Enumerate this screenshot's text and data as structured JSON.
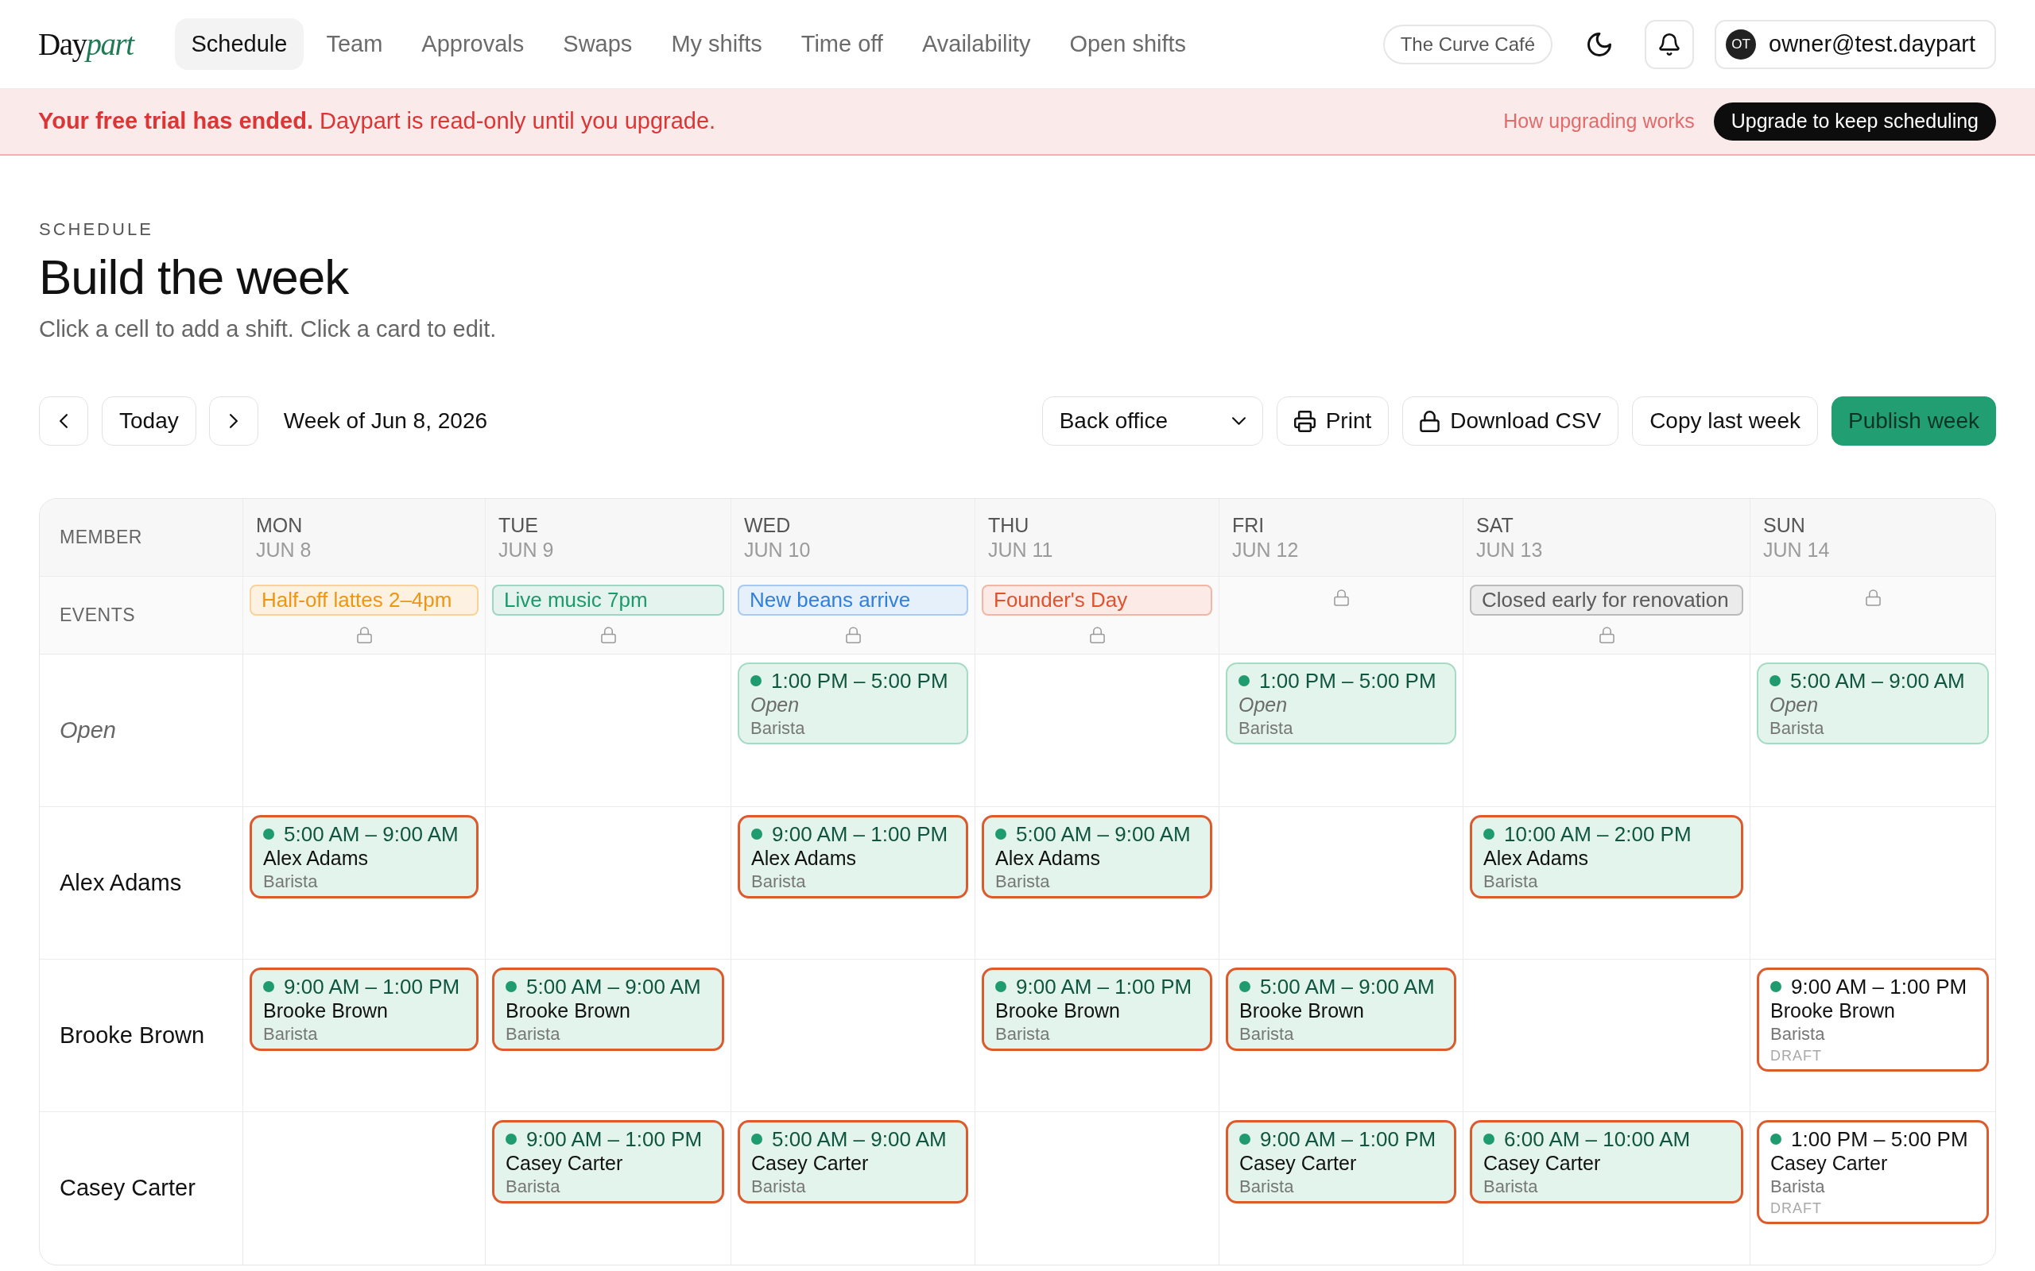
{
  "header": {
    "logo": {
      "lead": "Day",
      "accent": "part"
    },
    "nav": [
      {
        "label": "Schedule",
        "selected": true
      },
      {
        "label": "Team",
        "selected": false
      },
      {
        "label": "Approvals",
        "selected": false
      },
      {
        "label": "Swaps",
        "selected": false
      },
      {
        "label": "My shifts",
        "selected": false
      },
      {
        "label": "Time off",
        "selected": false
      },
      {
        "label": "Availability",
        "selected": false
      },
      {
        "label": "Open shifts",
        "selected": false
      }
    ],
    "workspace": "The Curve Café",
    "user": {
      "initials": "OT",
      "email": "owner@test.daypart"
    }
  },
  "banner": {
    "message": "**Your free trial has ended.** Daypart is read-only until you upgrade.",
    "link": "How upgrading works",
    "button": "Upgrade to keep scheduling"
  },
  "page": {
    "eyebrow": "SCHEDULE",
    "title": "Build the week",
    "subtitle": "Click a cell to add a shift. Click a card to edit."
  },
  "toolbar": {
    "today": "Today",
    "week": "Week of Jun 8, 2026",
    "location": "Back office",
    "actions": [
      {
        "kind": "print",
        "label": "Print"
      },
      {
        "kind": "download",
        "label": "Download CSV"
      },
      {
        "kind": "copy",
        "label": "Copy last week"
      },
      {
        "kind": "publish",
        "label": "Publish week"
      }
    ]
  },
  "schedule": {
    "member_heading": "MEMBER",
    "events_label": "EVENTS",
    "days": [
      {
        "day": "MON",
        "date": "JUN 8",
        "event": {
          "label": "Half-off lattes 2–4pm",
          "color": "#f0950f"
        }
      },
      {
        "day": "TUE",
        "date": "JUN 9",
        "event": {
          "label": "Live music 7pm",
          "color": "#1b9a6b"
        }
      },
      {
        "day": "WED",
        "date": "JUN 10",
        "event": {
          "label": "New beans arrive",
          "color": "#2f7fdf"
        }
      },
      {
        "day": "THU",
        "date": "JUN 11",
        "event": {
          "label": "Founder's Day",
          "color": "#df522c"
        }
      },
      {
        "day": "FRI",
        "date": "JUN 12"
      },
      {
        "day": "SAT",
        "date": "JUN 13",
        "event": {
          "label": "Closed early for renovation",
          "color": "#5a5a5a"
        }
      },
      {
        "day": "SUN",
        "date": "JUN 14"
      }
    ],
    "rows": [
      {
        "kind": "open",
        "member": "Open",
        "cells": [
          null,
          null,
          {
            "kind": "open",
            "time": "1:00 PM – 5:00 PM",
            "assignee": "Open",
            "role": "Barista",
            "draft": false
          },
          null,
          {
            "kind": "open",
            "time": "1:00 PM – 5:00 PM",
            "assignee": "Open",
            "role": "Barista",
            "draft": false
          },
          null,
          {
            "kind": "open",
            "time": "5:00 AM – 9:00 AM",
            "assignee": "Open",
            "role": "Barista",
            "draft": false
          }
        ]
      },
      {
        "kind": "member",
        "member": "Alex Adams",
        "cells": [
          {
            "kind": "assigned",
            "time": "5:00 AM – 9:00 AM",
            "assignee": "Alex Adams",
            "role": "Barista",
            "draft": false
          },
          null,
          {
            "kind": "assigned",
            "time": "9:00 AM – 1:00 PM",
            "assignee": "Alex Adams",
            "role": "Barista",
            "draft": false
          },
          {
            "kind": "assigned",
            "time": "5:00 AM – 9:00 AM",
            "assignee": "Alex Adams",
            "role": "Barista",
            "draft": false
          },
          null,
          {
            "kind": "assigned",
            "time": "10:00 AM – 2:00 PM",
            "assignee": "Alex Adams",
            "role": "Barista",
            "draft": false
          },
          null
        ]
      },
      {
        "kind": "member",
        "member": "Brooke Brown",
        "cells": [
          {
            "kind": "assigned",
            "time": "9:00 AM – 1:00 PM",
            "assignee": "Brooke Brown",
            "role": "Barista",
            "draft": false
          },
          {
            "kind": "assigned",
            "time": "5:00 AM – 9:00 AM",
            "assignee": "Brooke Brown",
            "role": "Barista",
            "draft": false
          },
          null,
          {
            "kind": "assigned",
            "time": "9:00 AM – 1:00 PM",
            "assignee": "Brooke Brown",
            "role": "Barista",
            "draft": false
          },
          {
            "kind": "assigned",
            "time": "5:00 AM – 9:00 AM",
            "assignee": "Brooke Brown",
            "role": "Barista",
            "draft": false
          },
          null,
          {
            "kind": "assigned",
            "time": "9:00 AM – 1:00 PM",
            "assignee": "Brooke Brown",
            "role": "Barista",
            "draft": true,
            "draft_label": "DRAFT"
          }
        ]
      },
      {
        "kind": "member",
        "member": "Casey Carter",
        "cells": [
          null,
          {
            "kind": "assigned",
            "time": "9:00 AM – 1:00 PM",
            "assignee": "Casey Carter",
            "role": "Barista",
            "draft": false
          },
          {
            "kind": "assigned",
            "time": "5:00 AM – 9:00 AM",
            "assignee": "Casey Carter",
            "role": "Barista",
            "draft": false
          },
          null,
          {
            "kind": "assigned",
            "time": "9:00 AM – 1:00 PM",
            "assignee": "Casey Carter",
            "role": "Barista",
            "draft": false
          },
          {
            "kind": "assigned",
            "time": "6:00 AM – 10:00 AM",
            "assignee": "Casey Carter",
            "role": "Barista",
            "draft": false
          },
          {
            "kind": "assigned",
            "time": "1:00 PM – 5:00 PM",
            "assignee": "Casey Carter",
            "role": "Barista",
            "draft": true,
            "draft_label": "DRAFT"
          }
        ]
      }
    ]
  }
}
